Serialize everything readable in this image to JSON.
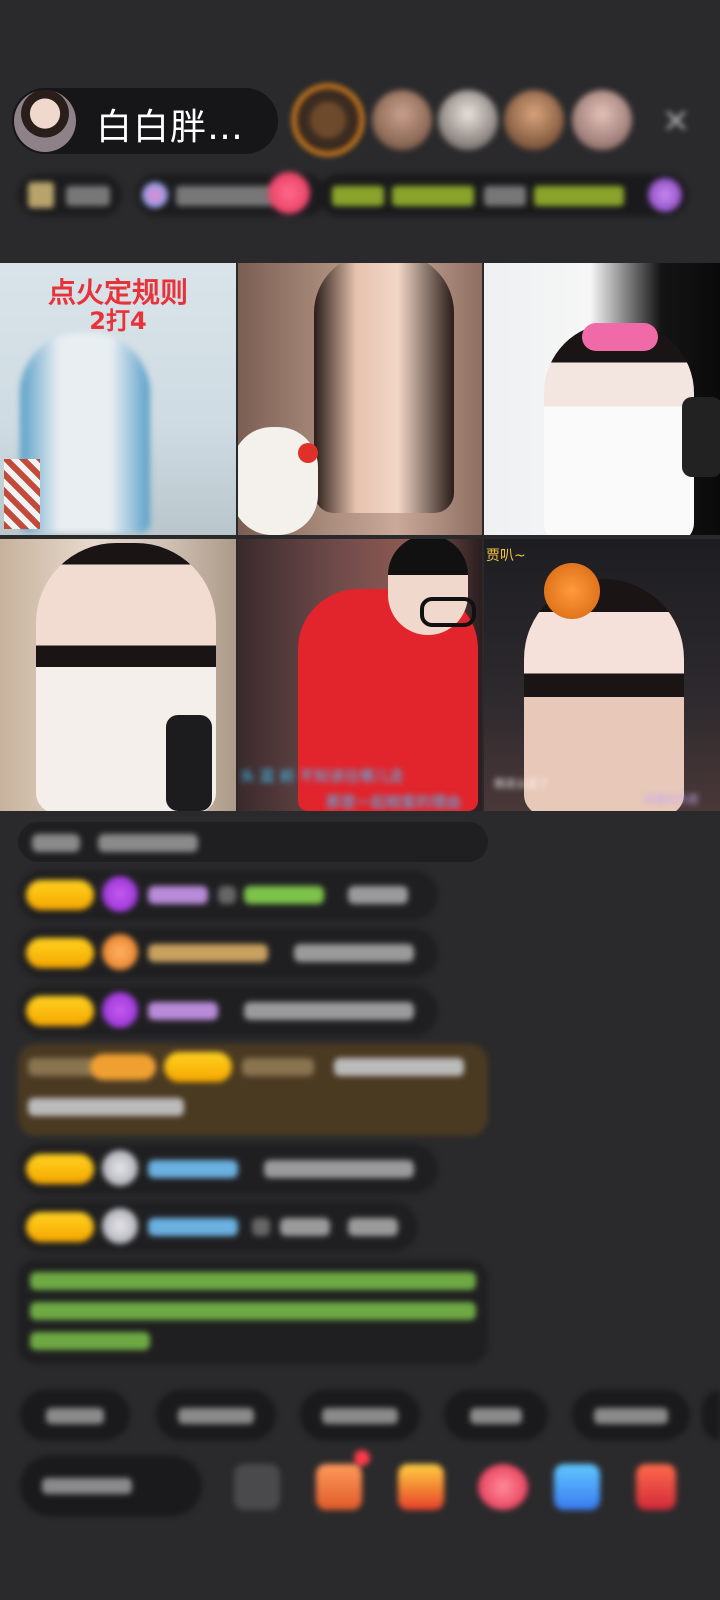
{
  "header": {
    "host_name": "白白胖…",
    "close_icon": "×"
  },
  "video_grid": {
    "cover_title_line1": "点火定规则",
    "cover_title_line2": "2打4",
    "cell5_sub_line1": "头 蓝  前 不知该往哪儿走",
    "cell5_sub_line2": "那是一起相爱的理由",
    "cell6_top_text": "贾叭~",
    "cell6_sub_left": "就这么定了",
    "cell6_sub_right": "收藏欢乐愿"
  },
  "colors": {
    "badge_gold": "#ffd21f",
    "accent_orange": "#f08a1c",
    "chat_bg": "#1f1f21",
    "system_msg_green": "#7dc24a"
  }
}
